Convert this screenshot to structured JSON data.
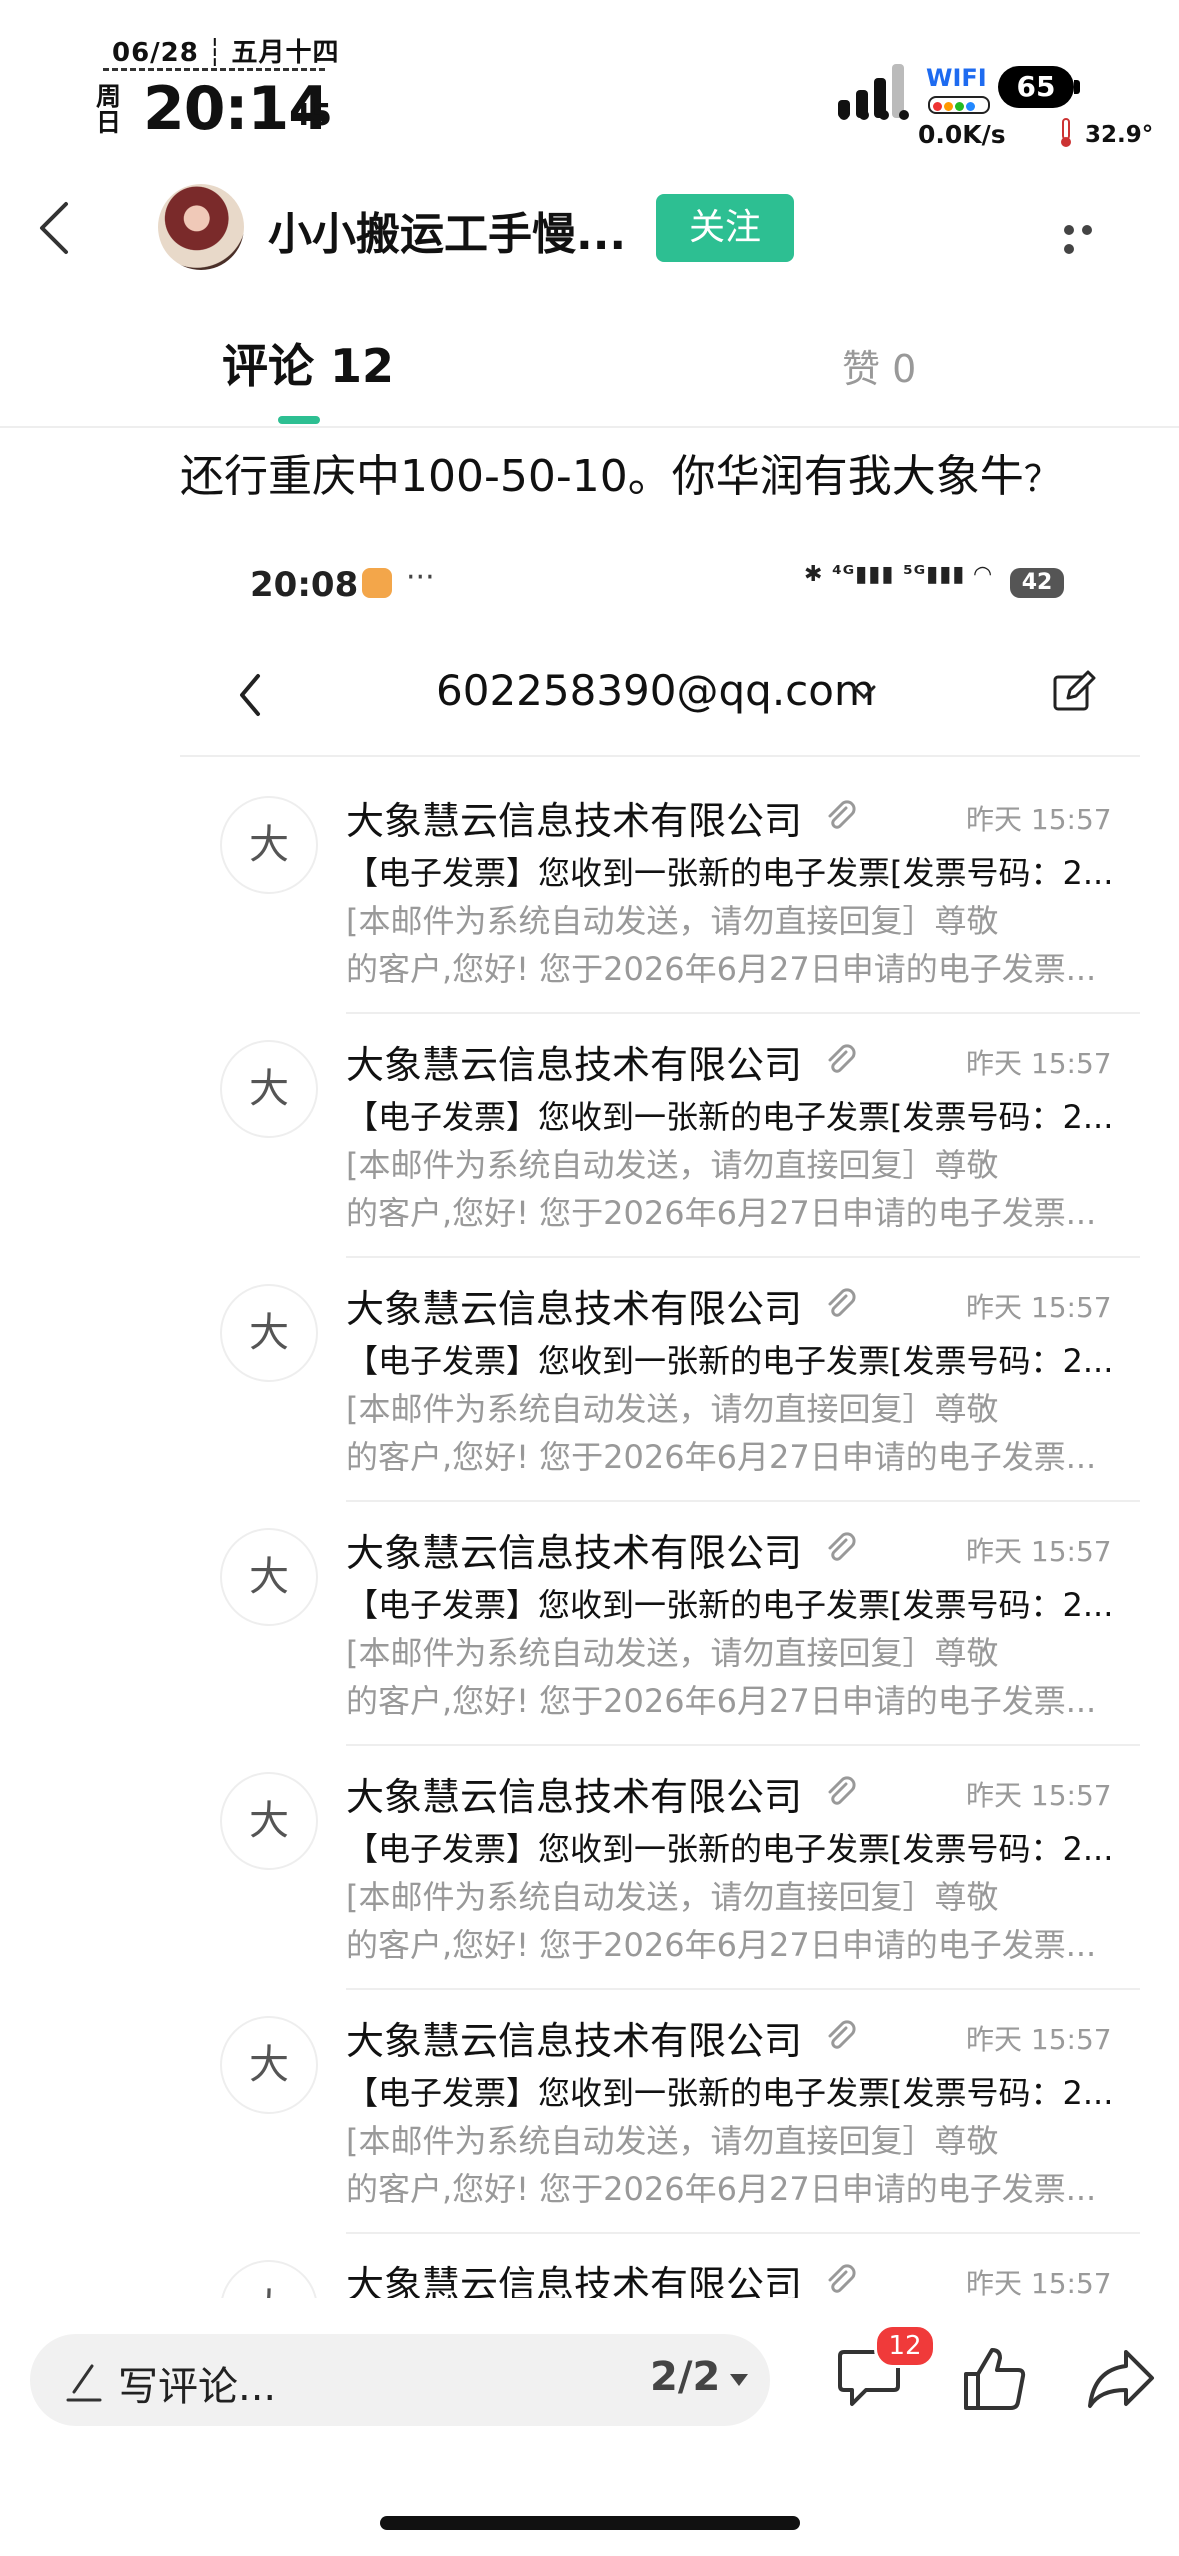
{
  "status_bar": {
    "date": "06/28",
    "lunar": "五月十四",
    "weekday": "周日",
    "time": "20:14",
    "seconds": "45",
    "wifi_label": "WIFI",
    "battery": "65",
    "net_speed": "0.0K/s",
    "temperature": "32.9°"
  },
  "header": {
    "author": "小小搬运工手慢...",
    "follow_label": "关注",
    "tabs": [
      {
        "label": "评论 12",
        "active": true
      },
      {
        "label": "赞 0",
        "active": false
      }
    ]
  },
  "post": {
    "text": "还行重庆中100-50-10。你华润有我大象牛",
    "text_tail": "？"
  },
  "embedded": {
    "time": "20:08",
    "dots": "···",
    "status_text": "✱ ⁴ᴳ▮▮▮ ⁵ᴳ▮▮▮ ◠",
    "battery": "42",
    "email": "602258390@qq.com",
    "mails": [
      {
        "avatar": "大",
        "sender": "大象慧云信息技术有限公司",
        "time": "昨天 15:57",
        "subject": "【电子发票】您收到一张新的电子发票[发票号码：2...",
        "preview1": "      [本邮件为系统自动发送，请勿直接回复］尊敬",
        "preview2": "的客户,您好!  您于2026年6月27日申请的电子发票..."
      },
      {
        "avatar": "大",
        "sender": "大象慧云信息技术有限公司",
        "time": "昨天 15:57",
        "subject": "【电子发票】您收到一张新的电子发票[发票号码：2...",
        "preview1": "      [本邮件为系统自动发送，请勿直接回复］尊敬",
        "preview2": "的客户,您好!  您于2026年6月27日申请的电子发票..."
      },
      {
        "avatar": "大",
        "sender": "大象慧云信息技术有限公司",
        "time": "昨天 15:57",
        "subject": "【电子发票】您收到一张新的电子发票[发票号码：2...",
        "preview1": "      [本邮件为系统自动发送，请勿直接回复］尊敬",
        "preview2": "的客户,您好!  您于2026年6月27日申请的电子发票..."
      },
      {
        "avatar": "大",
        "sender": "大象慧云信息技术有限公司",
        "time": "昨天 15:57",
        "subject": "【电子发票】您收到一张新的电子发票[发票号码：2...",
        "preview1": "      [本邮件为系统自动发送，请勿直接回复］尊敬",
        "preview2": "的客户,您好!  您于2026年6月27日申请的电子发票..."
      },
      {
        "avatar": "大",
        "sender": "大象慧云信息技术有限公司",
        "time": "昨天 15:57",
        "subject": "【电子发票】您收到一张新的电子发票[发票号码：2...",
        "preview1": "      [本邮件为系统自动发送，请勿直接回复］尊敬",
        "preview2": "的客户,您好!  您于2026年6月27日申请的电子发票..."
      },
      {
        "avatar": "大",
        "sender": "大象慧云信息技术有限公司",
        "time": "昨天 15:57",
        "subject": "【电子发票】您收到一张新的电子发票[发票号码：2...",
        "preview1": "      [本邮件为系统自动发送，请勿直接回复］尊敬",
        "preview2": "的客户,您好!  您于2026年6月27日申请的电子发票..."
      },
      {
        "avatar": "大",
        "sender": "大象慧云信息技术有限公司",
        "time": "昨天 15:57",
        "subject": "",
        "preview1": "",
        "preview2": ""
      }
    ]
  },
  "bottom_bar": {
    "comment_placeholder": "写评论...",
    "page_indicator": "2/2",
    "comment_badge": "12"
  },
  "icons": {
    "back": "chevron-left-icon",
    "more": "more-dots-icon",
    "attachment": "paperclip-icon",
    "compose": "edit-icon",
    "comment": "comment-bubble-icon",
    "like": "thumbs-up-icon",
    "share": "share-arrow-icon"
  },
  "colors": {
    "accent": "#2dbf92",
    "badge": "#f03a3a",
    "wifi": "#1e6bf0"
  }
}
